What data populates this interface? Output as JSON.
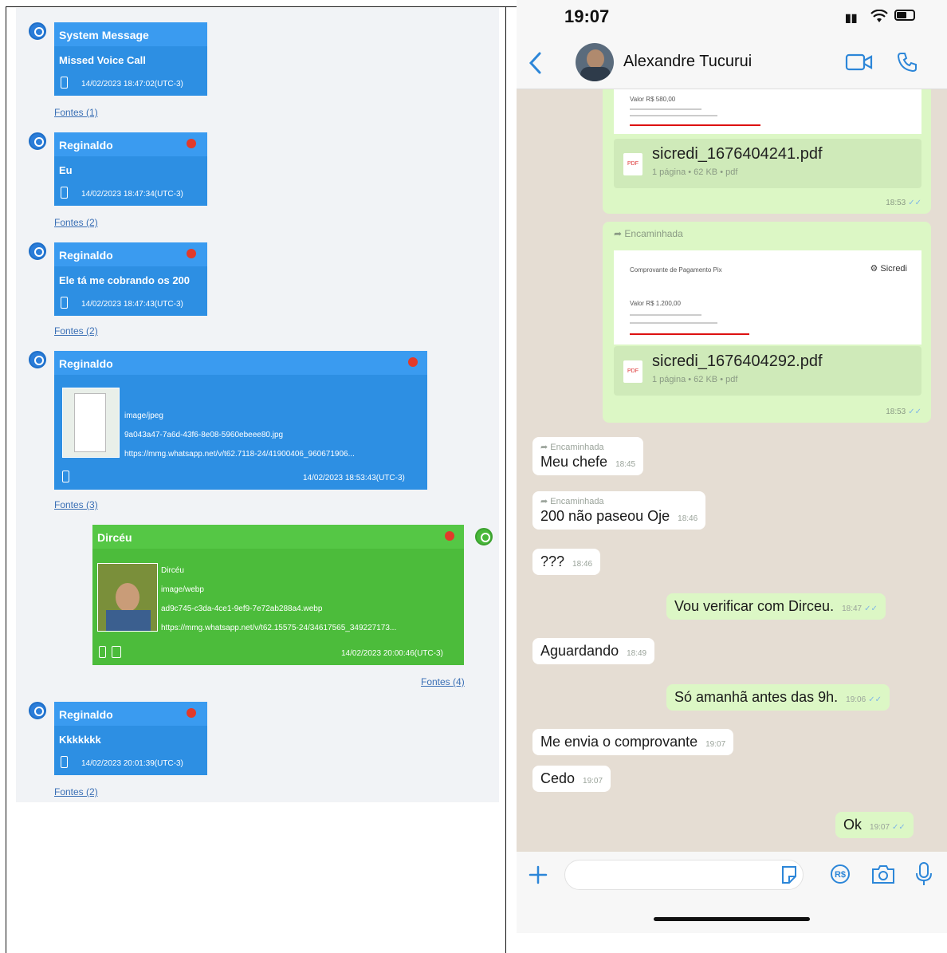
{
  "left_panel": {
    "messages": [
      {
        "sender": "System Message",
        "text": "Missed Voice Call",
        "timestamp": "14/02/2023 18:47:02(UTC-3)",
        "fontes": "Fontes (1)"
      },
      {
        "sender": "Reginaldo",
        "text": "Eu",
        "timestamp": "14/02/2023 18:47:34(UTC-3)",
        "fontes": "Fontes (2)"
      },
      {
        "sender": "Reginaldo",
        "text": "Ele tá me cobrando os 200",
        "timestamp": "14/02/2023 18:47:43(UTC-3)",
        "fontes": "Fontes (2)"
      },
      {
        "sender": "Reginaldo",
        "mime": "image/jpeg",
        "file": "9a043a47-7a6d-43f6-8e08-5960ebeee80.jpg",
        "url": "https://mmg.whatsapp.net/v/t62.7118-24/41900406_960671906...",
        "timestamp": "14/02/2023 18:53:43(UTC-3)",
        "fontes": "Fontes (3)"
      },
      {
        "sender": "Dircéu",
        "caption": "Dircéu",
        "mime": "image/webp",
        "file": "ad9c745-c3da-4ce1-9ef9-7e72ab288a4.webp",
        "url": "https://mmg.whatsapp.net/v/t62.15575-24/34617565_349227173...",
        "timestamp": "14/02/2023 20:00:46(UTC-3)",
        "fontes": "Fontes (4)"
      },
      {
        "sender": "Reginaldo",
        "text": "Kkkkkkk",
        "timestamp": "14/02/2023 20:01:39(UTC-3)",
        "fontes": "Fontes (2)"
      }
    ]
  },
  "right_panel": {
    "status_time": "19:07",
    "contact_name": "Alexandre Tucurui",
    "attachments": [
      {
        "receipt_value": "Valor R$ 580,00",
        "filename": "sicredi_1676404241.pdf",
        "meta": "1 página • 62 KB • pdf",
        "time": "18:53"
      },
      {
        "forwarded": "Encaminhada",
        "receipt_title": "Comprovante de Pagamento Pix",
        "bank": "Sicredi",
        "receipt_value": "Valor R$ 1.200,00",
        "filename": "sicredi_1676404292.pdf",
        "meta": "1 página • 62 KB • pdf",
        "time": "18:53"
      }
    ],
    "messages": [
      {
        "dir": "in",
        "forwarded": "Encaminhada",
        "text": "Meu chefe",
        "time": "18:45"
      },
      {
        "dir": "in",
        "forwarded": "Encaminhada",
        "text": "200 não paseou Oje",
        "time": "18:46"
      },
      {
        "dir": "in",
        "text": "???",
        "time": "18:46"
      },
      {
        "dir": "out",
        "text": "Vou verificar com Dirceu.",
        "time": "18:47"
      },
      {
        "dir": "in",
        "text": "Aguardando",
        "time": "18:49"
      },
      {
        "dir": "out",
        "text": "Só amanhã antes das 9h.",
        "time": "19:06"
      },
      {
        "dir": "in",
        "text": "Me envia o comprovante",
        "time": "19:07"
      },
      {
        "dir": "in",
        "text": "Cedo",
        "time": "19:07"
      },
      {
        "dir": "out",
        "text": "Ok",
        "time": "19:07"
      }
    ]
  },
  "colors": {
    "blue_bubble": "#2d8fe3",
    "green_bubble": "#4cbc3b",
    "wa_out": "#dcf7c5",
    "wa_bg": "#e5ddd3",
    "accent": "#2c86d8"
  },
  "icons": [
    "back-icon",
    "video-call-icon",
    "phone-icon",
    "plus-icon",
    "sticker-icon",
    "currency-icon",
    "camera-icon",
    "mic-icon",
    "pdf-icon"
  ]
}
